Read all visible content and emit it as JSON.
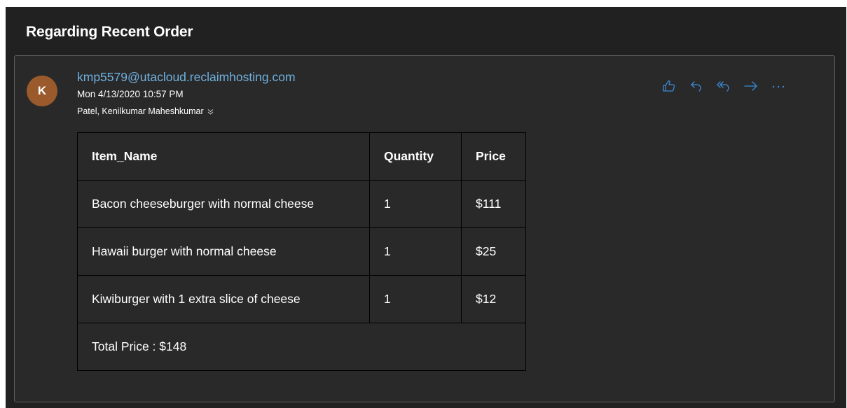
{
  "email": {
    "subject": "Regarding Recent Order",
    "avatar_initial": "K",
    "avatar_color": "#9a5a2c",
    "sender": "kmp5579@utacloud.reclaimhosting.com",
    "date": "Mon 4/13/2020 10:57 PM",
    "recipient": "Patel, Kenilkumar Maheshkumar",
    "accent_color": "#3b8ad6",
    "link_color": "#6fb0de"
  },
  "actions": [
    {
      "icon": "like-icon"
    },
    {
      "icon": "reply-icon"
    },
    {
      "icon": "reply-all-icon"
    },
    {
      "icon": "forward-icon"
    },
    {
      "icon": "more-icon"
    }
  ],
  "table": {
    "headers": [
      "Item_Name",
      "Quantity",
      "Price"
    ],
    "rows": [
      [
        "Bacon cheeseburger with normal cheese",
        "1",
        "$111"
      ],
      [
        "Hawaii burger with normal cheese",
        "1",
        "$25"
      ],
      [
        "Kiwiburger with 1 extra slice of cheese",
        "1",
        "$12"
      ]
    ],
    "total": "Total Price : $148"
  }
}
